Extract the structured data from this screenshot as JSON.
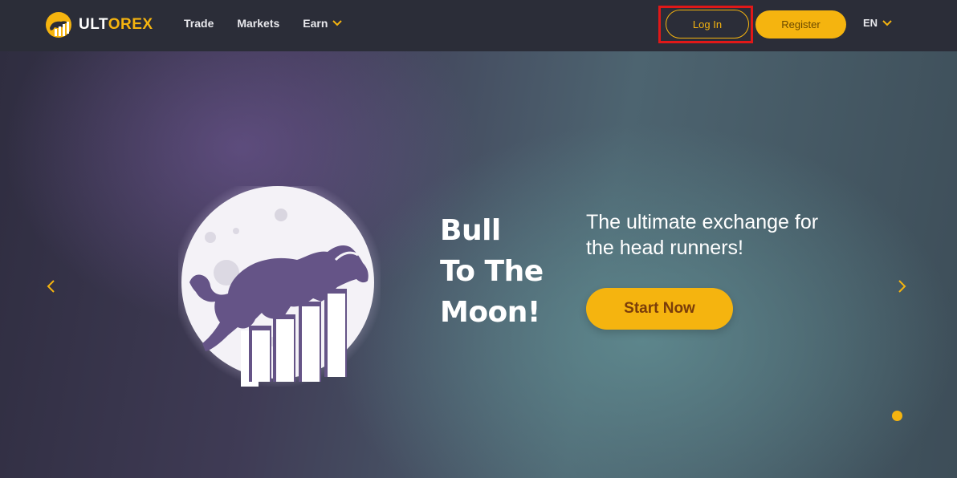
{
  "brand": {
    "name_part1": "ULT",
    "name_part2": "OREX",
    "logo_icon": "bull-logo-icon"
  },
  "nav": {
    "items": [
      {
        "label": "Trade"
      },
      {
        "label": "Markets"
      },
      {
        "label": "Earn",
        "icon": "chevron-down-icon"
      }
    ]
  },
  "auth": {
    "login_label": "Log In",
    "register_label": "Register"
  },
  "language": {
    "selected": "EN",
    "icon": "chevron-down-icon"
  },
  "hero": {
    "tagline": [
      "Bull",
      "To The",
      "Moon!"
    ],
    "subtitle": "The ultimate exchange for the head runners!",
    "cta_label": "Start Now",
    "illustration_icon": "bull-moon-illustration-icon",
    "slider": {
      "prev_icon": "chevron-left-icon",
      "next_icon": "chevron-right-icon",
      "active_slide": 1,
      "slide_count": 1
    }
  },
  "colors": {
    "accent": "#f5b40f",
    "header_bg": "#2b2d38",
    "highlight_box": "#e01818",
    "illustration_fill": "#655487"
  }
}
